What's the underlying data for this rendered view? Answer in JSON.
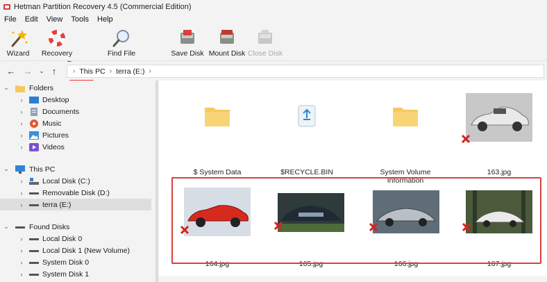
{
  "window": {
    "title": "Hetman Partition Recovery 4.5 (Commercial Edition)"
  },
  "menu": [
    "File",
    "Edit",
    "View",
    "Tools",
    "Help"
  ],
  "toolbar": {
    "wizard": "Wizard",
    "recovery": "Recovery",
    "find_file": "Find File",
    "save_disk": "Save Disk",
    "mount_disk": "Mount Disk",
    "close_disk": "Close Disk"
  },
  "address": {
    "crumbs": [
      "This PC",
      "terra (E:)"
    ]
  },
  "tree": {
    "folders": "Folders",
    "folder_items": [
      "Desktop",
      "Documents",
      "Music",
      "Pictures",
      "Videos"
    ],
    "this_pc": "This PC",
    "pc_items": [
      "Local Disk (C:)",
      "Removable Disk (D:)",
      "terra (E:)"
    ],
    "found_disks": "Found Disks",
    "found_items": [
      "Local Disk 0",
      "Local Disk 1 (New Volume)",
      "System Disk 0",
      "System Disk 1"
    ]
  },
  "files": {
    "row1": [
      "$ System Data",
      "$RECYCLE.BIN",
      "System Volume Information",
      "163.jpg"
    ],
    "row2": [
      "164.jpg",
      "165.jpg",
      "166.jpg",
      "167.jpg"
    ]
  },
  "colors": {
    "accent": "#d9403a",
    "folder": "#f6c85f",
    "selection": "#dedede"
  }
}
